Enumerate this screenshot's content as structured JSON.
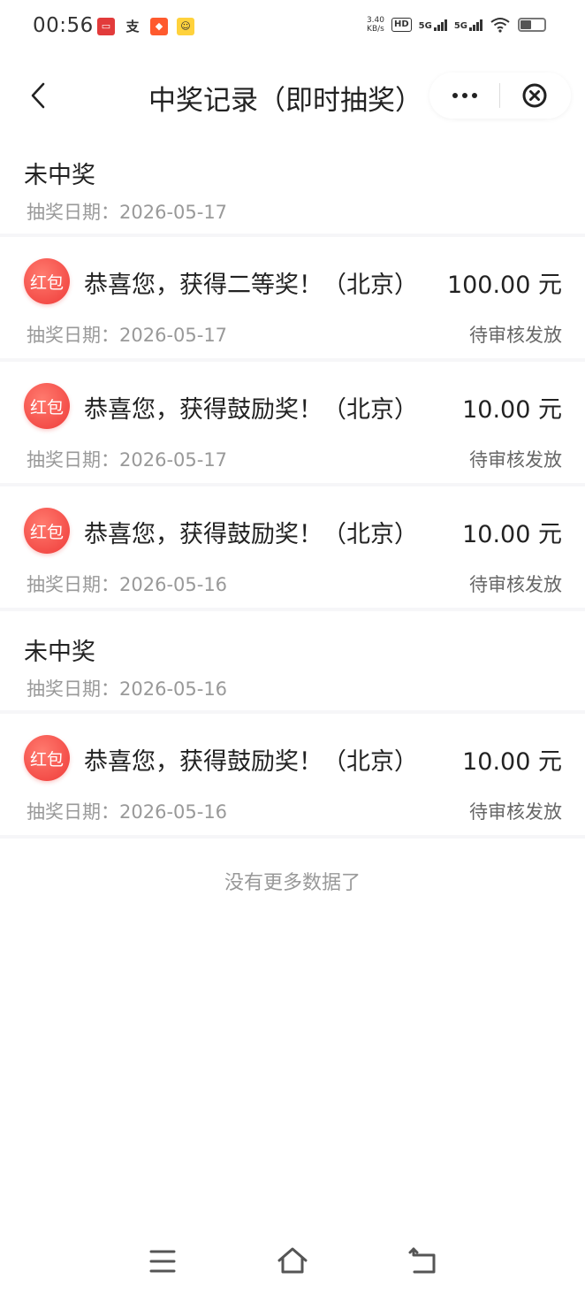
{
  "status_bar": {
    "time": "00:56",
    "net_speed_value": "3.40",
    "net_speed_unit": "KB/s",
    "hd_label": "HD",
    "signal1_label": "5G",
    "signal2_label": "5G",
    "notification_icons": [
      "tv-app-icon",
      "alipay-icon",
      "shopping-app-icon",
      "game-app-icon"
    ],
    "status_icons": [
      "hd-icon",
      "signal-5g-icon",
      "signal-5g-icon",
      "wifi-icon",
      "battery-icon"
    ]
  },
  "nav": {
    "title": "中奖记录（即时抽奖）",
    "back_icon": "chevron-left-icon",
    "more_icon": "more-dots-icon",
    "close_icon": "close-circle-icon"
  },
  "records": [
    {
      "type": "nowin",
      "title": "未中奖",
      "date": "抽奖日期：2026-05-17"
    },
    {
      "type": "win",
      "badge": "红包",
      "text": "恭喜您，获得二等奖！（北京）",
      "amount": "100.00 元",
      "date": "抽奖日期：2026-05-17",
      "status": "待审核发放"
    },
    {
      "type": "win",
      "badge": "红包",
      "text": "恭喜您，获得鼓励奖！（北京）",
      "amount": "10.00 元",
      "date": "抽奖日期：2026-05-17",
      "status": "待审核发放"
    },
    {
      "type": "win",
      "badge": "红包",
      "text": "恭喜您，获得鼓励奖！（北京）",
      "amount": "10.00 元",
      "date": "抽奖日期：2026-05-16",
      "status": "待审核发放"
    },
    {
      "type": "nowin",
      "title": "未中奖",
      "date": "抽奖日期：2026-05-16"
    },
    {
      "type": "win",
      "badge": "红包",
      "text": "恭喜您，获得鼓励奖！（北京）",
      "amount": "10.00 元",
      "date": "抽奖日期：2026-05-16",
      "status": "待审核发放"
    }
  ],
  "footer": {
    "no_more": "没有更多数据了"
  },
  "bottom_nav": {
    "icons": [
      "menu-icon",
      "home-icon",
      "back-icon"
    ]
  },
  "colors": {
    "badge_red": "#ef3b39",
    "muted_text": "#999999",
    "divider": "#f6f6f8"
  }
}
